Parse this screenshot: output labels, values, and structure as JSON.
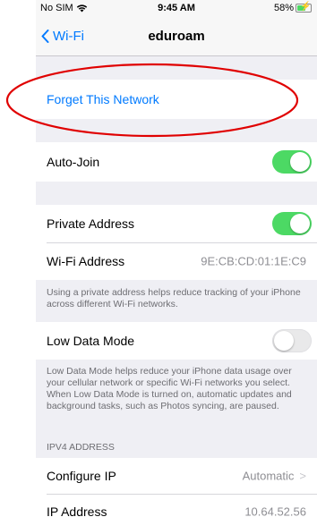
{
  "status_bar": {
    "carrier": "No SIM",
    "time": "9:45 AM",
    "battery": "58%"
  },
  "nav": {
    "back_label": "Wi-Fi",
    "title": "eduroam"
  },
  "forget_network": {
    "label": "Forget This Network"
  },
  "auto_join": {
    "label": "Auto-Join",
    "enabled": true
  },
  "private_address": {
    "label": "Private Address",
    "enabled": true,
    "wifi_address_label": "Wi-Fi Address",
    "wifi_address_value": "9E:CB:CD:01:1E:C9",
    "footer": "Using a private address helps reduce tracking of your iPhone across different Wi-Fi networks."
  },
  "low_data_mode": {
    "label": "Low Data Mode",
    "enabled": false,
    "footer": "Low Data Mode helps reduce your iPhone data usage over your cellular network or specific Wi-Fi networks you select. When Low Data Mode is turned on, automatic updates and background tasks, such as Photos syncing, are paused."
  },
  "ipv4": {
    "header": "IPV4 ADDRESS",
    "configure_ip_label": "Configure IP",
    "configure_ip_value": "Automatic",
    "ip_address_label": "IP Address",
    "ip_address_value": "10.64.52.56"
  },
  "colors": {
    "accent": "#007aff",
    "toggle_on": "#4cd964",
    "annotation": "#e00000"
  }
}
